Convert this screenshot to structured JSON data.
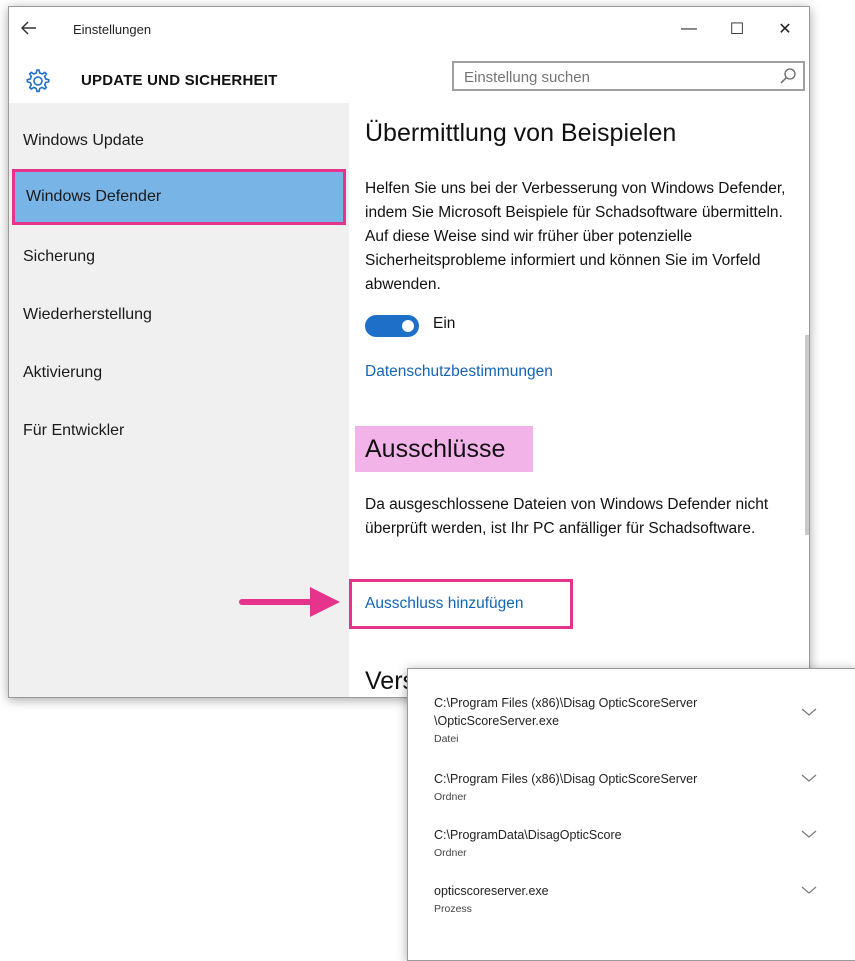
{
  "titlebar": {
    "back_icon": "back-arrow-icon",
    "title": "Einstellungen",
    "minimize": "—",
    "maximize": "☐",
    "close": "✕"
  },
  "header": {
    "icon": "gear-icon",
    "title": "UPDATE UND SICHERHEIT",
    "search_placeholder": "Einstellung suchen"
  },
  "sidebar": {
    "items": [
      {
        "label": "Windows Update"
      },
      {
        "label": "Windows Defender",
        "selected": true
      },
      {
        "label": "Sicherung"
      },
      {
        "label": "Wiederherstellung"
      },
      {
        "label": "Aktivierung"
      },
      {
        "label": "Für Entwickler"
      }
    ]
  },
  "main": {
    "sample_section": {
      "title": "Übermittlung von Beispielen",
      "description": "Helfen Sie uns bei der Verbesserung von Windows Defender, indem Sie Microsoft Beispiele für Schadsoftware übermitteln. Auf diese Weise sind wir früher über potenzielle Sicherheitsprobleme informiert und können Sie im Vorfeld abwenden.",
      "toggle_state": "on",
      "toggle_label": "Ein",
      "privacy_link": "Datenschutzbestimmungen"
    },
    "exclusions_section": {
      "title": "Ausschlüsse",
      "description": "Da ausgeschlossene Dateien von Windows Defender nicht überprüft werden, ist Ihr PC anfälliger für Schadsoftware.",
      "add_link": "Ausschluss hinzufügen"
    },
    "version_section": {
      "title": "Versionsinfo"
    }
  },
  "exclusions_list": {
    "items": [
      {
        "path_line1": "C:\\Program Files (x86)\\Disag OpticScoreServer",
        "path_line2": "\\OpticScoreServer.exe",
        "type": "Datei"
      },
      {
        "path_line1": "C:\\Program Files (x86)\\Disag OpticScoreServer",
        "type": "Ordner"
      },
      {
        "path_line1": "C:\\ProgramData\\DisagOpticScore",
        "type": "Ordner"
      },
      {
        "path_line1": "opticscoreserver.exe",
        "type": "Prozess"
      }
    ]
  },
  "colors": {
    "accent": "#1e6fc7",
    "link": "#1464b4",
    "selection": "#79b4e6",
    "annotation_pink": "#e6338c",
    "highlight_pink": "#f2b3e8"
  }
}
